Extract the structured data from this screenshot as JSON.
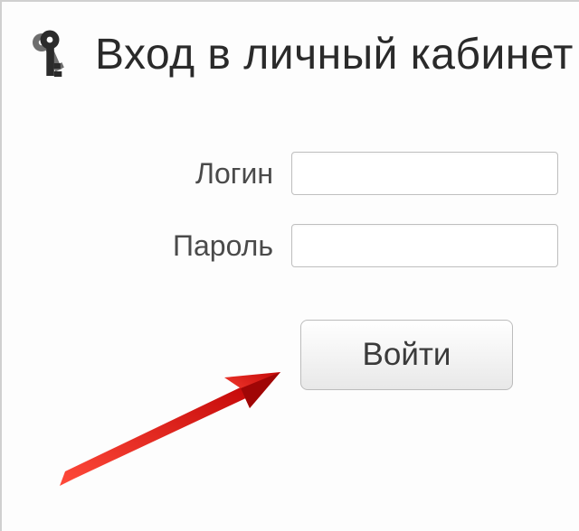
{
  "header": {
    "title": "Вход в личный кабинет",
    "icon": "keys-icon"
  },
  "form": {
    "login_label": "Логин",
    "login_value": "",
    "password_label": "Пароль",
    "password_value": "",
    "submit_label": "Войти"
  },
  "annotation": {
    "arrow_color": "#e61b1b"
  }
}
